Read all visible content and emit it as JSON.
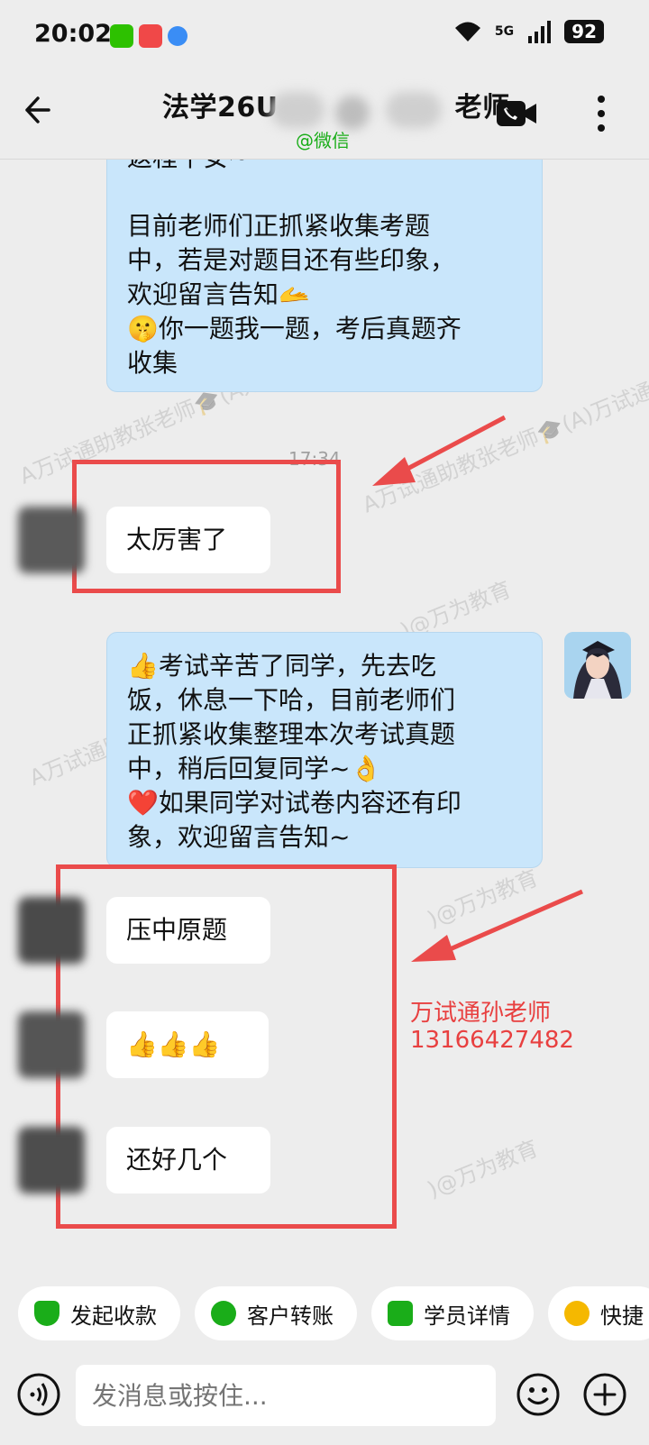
{
  "status_bar": {
    "time": "20:02",
    "network": "5G",
    "battery": "92"
  },
  "header": {
    "title_left": "法学26U",
    "title_right": "老师",
    "subtitle": "@微信"
  },
  "timestamp": "17:34",
  "watermarks": [
    "A万试通助教张老师🎓(A万试通",
    "A万试通助教张老师🎓(A)万试通",
    ")@万为教育",
    "A万试通助教张老师🎓(A万试通助",
    ")@万为教育",
    ")@万为教育"
  ],
  "messages": {
    "m1": {
      "lines": [
        "返程平安~",
        "",
        "目前老师们正抓紧收集考题",
        "中，若是对题目还有些印象，",
        "欢迎留言告知🫴",
        "🤫你一题我一题，考后真题齐",
        "收集"
      ]
    },
    "m2": {
      "text": "太厉害了"
    },
    "m3": {
      "lines": [
        "👍考试辛苦了同学，先去吃",
        "饭，休息一下哈，目前老师们",
        "正抓紧收集整理本次考试真题",
        "中，稍后回复同学~👌",
        "❤️如果同学对试卷内容还有印",
        "象，欢迎留言告知~"
      ]
    },
    "m4": {
      "text": "压中原题"
    },
    "m5": {
      "text": "👍👍👍"
    },
    "m6": {
      "text": "还好几个"
    }
  },
  "annotation": {
    "name": "万试通孙老师",
    "phone": "13166427482"
  },
  "quick_actions": [
    {
      "label": "发起收款",
      "color": "#1aad19"
    },
    {
      "label": "客户转账",
      "color": "#1aad19"
    },
    {
      "label": "学员详情",
      "color": "#1aad19"
    },
    {
      "label": "快捷",
      "color": "#f5b800"
    }
  ],
  "input": {
    "placeholder": "发消息或按住..."
  },
  "colors": {
    "annotation_red": "#ea4b4b",
    "bubble_out": "#c9e6fb",
    "bubble_in": "#ffffff"
  }
}
